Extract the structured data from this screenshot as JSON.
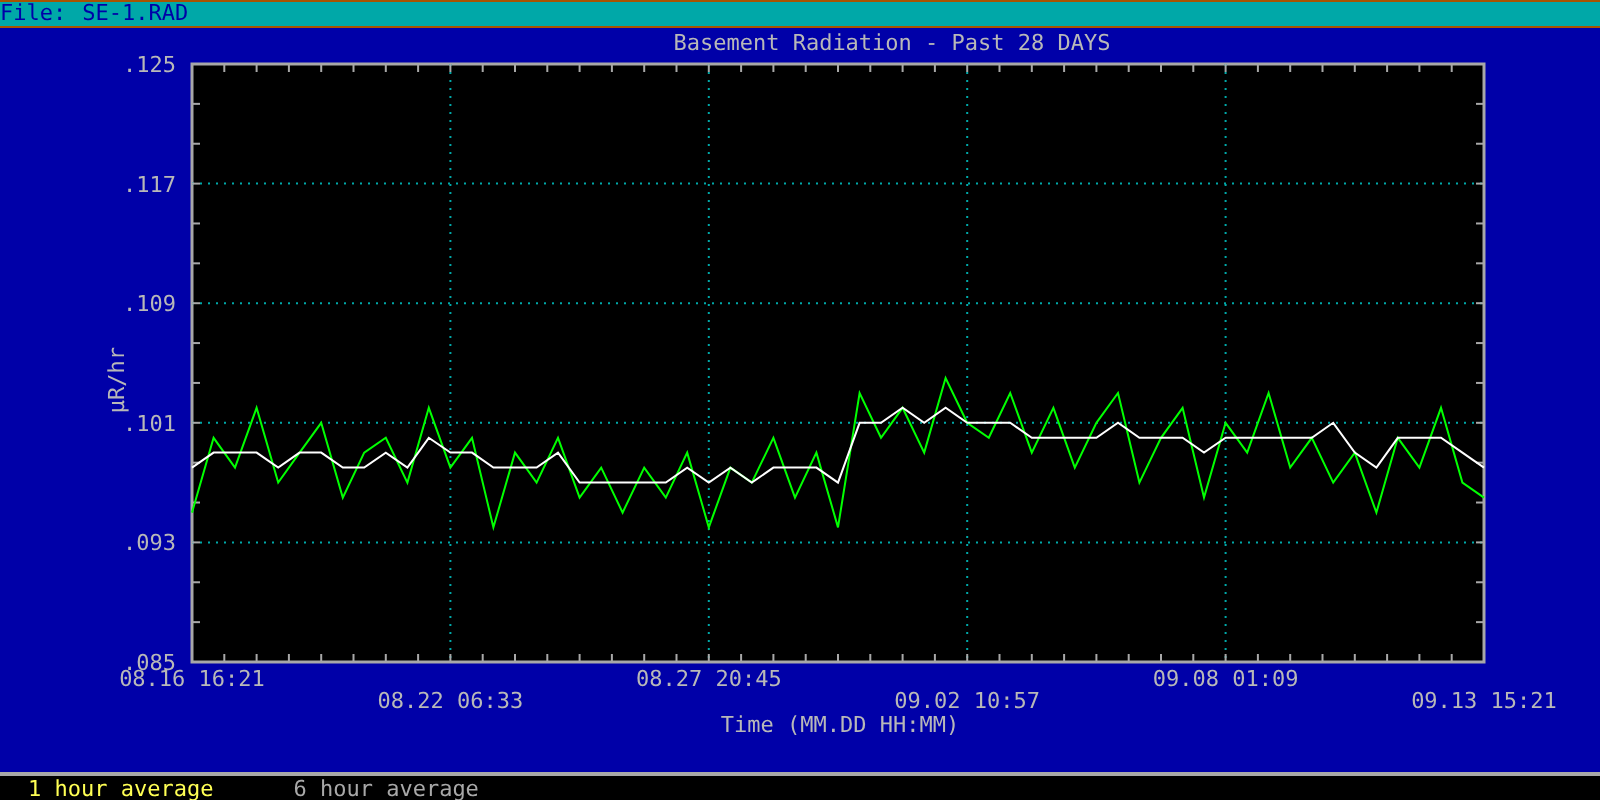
{
  "file_bar": {
    "label": "File:",
    "filename": "SE-1.RAD"
  },
  "chart": {
    "chart_data": {
      "type": "line",
      "title": "Basement Radiation - Past 28 DAYS",
      "xlabel": "Time (MM.DD HH:MM)",
      "ylabel": "µR/hr",
      "categories": [
        "08.16 16:21",
        null,
        null,
        null,
        null,
        null,
        null,
        null,
        null,
        null,
        null,
        null,
        "08.22 06:33",
        null,
        null,
        null,
        null,
        null,
        null,
        null,
        null,
        null,
        null,
        null,
        "08.27 20:45",
        null,
        null,
        null,
        null,
        null,
        null,
        null,
        null,
        null,
        null,
        null,
        "09.02 10:57",
        null,
        null,
        null,
        null,
        null,
        null,
        null,
        null,
        null,
        null,
        null,
        "09.08 01:09",
        null,
        null,
        null,
        null,
        null,
        null,
        null,
        null,
        null,
        null,
        null,
        "09.13 15:21"
      ],
      "grid": true,
      "ylim": [
        0.085,
        0.125
      ],
      "yticks": [
        {
          "value": 0.085,
          "label": ".085"
        },
        {
          "value": 0.093,
          "label": ".093"
        },
        {
          "value": 0.101,
          "label": ".101"
        },
        {
          "value": 0.109,
          "label": ".109"
        },
        {
          "value": 0.117,
          "label": ".117"
        },
        {
          "value": 0.125,
          "label": ".125"
        }
      ],
      "series": [
        {
          "name": "1 hour average",
          "color": "#00ff00",
          "values": [
            0.095,
            0.1,
            0.098,
            0.102,
            0.097,
            0.099,
            0.101,
            0.096,
            0.099,
            0.1,
            0.097,
            0.102,
            0.098,
            0.1,
            0.094,
            0.099,
            0.097,
            0.1,
            0.096,
            0.098,
            0.095,
            0.098,
            0.096,
            0.099,
            0.094,
            0.098,
            0.097,
            0.1,
            0.096,
            0.099,
            0.094,
            0.103,
            0.1,
            0.102,
            0.099,
            0.104,
            0.101,
            0.1,
            0.103,
            0.099,
            0.102,
            0.098,
            0.101,
            0.103,
            0.097,
            0.1,
            0.102,
            0.096,
            0.101,
            0.099,
            0.103,
            0.098,
            0.1,
            0.097,
            0.099,
            0.095,
            0.1,
            0.098,
            0.102,
            0.097,
            0.096
          ]
        },
        {
          "name": "6 hour average",
          "color": "#ffffff",
          "values": [
            0.098,
            0.099,
            0.099,
            0.099,
            0.098,
            0.099,
            0.099,
            0.098,
            0.098,
            0.099,
            0.098,
            0.1,
            0.099,
            0.099,
            0.098,
            0.098,
            0.098,
            0.099,
            0.097,
            0.097,
            0.097,
            0.097,
            0.097,
            0.098,
            0.097,
            0.098,
            0.097,
            0.098,
            0.098,
            0.098,
            0.097,
            0.101,
            0.101,
            0.102,
            0.101,
            0.102,
            0.101,
            0.101,
            0.101,
            0.1,
            0.1,
            0.1,
            0.1,
            0.101,
            0.1,
            0.1,
            0.1,
            0.099,
            0.1,
            0.1,
            0.1,
            0.1,
            0.1,
            0.101,
            0.099,
            0.098,
            0.1,
            0.1,
            0.1,
            0.099,
            0.098
          ]
        }
      ]
    }
  },
  "legend": [
    {
      "selected": true
    },
    {
      "selected": false
    }
  ]
}
